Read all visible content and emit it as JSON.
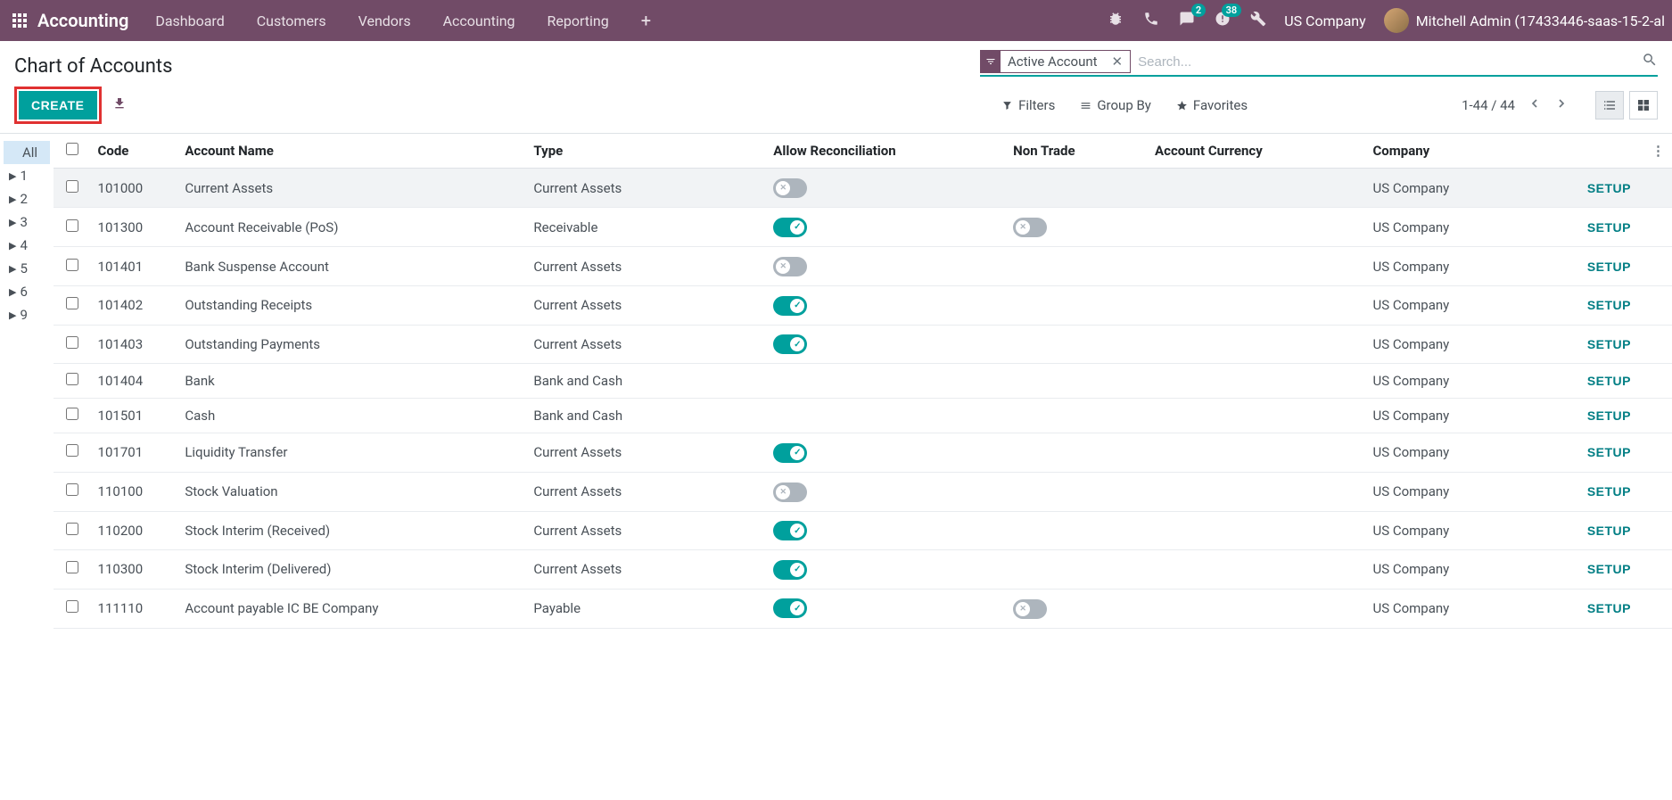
{
  "navbar": {
    "brand": "Accounting",
    "menu": [
      "Dashboard",
      "Customers",
      "Vendors",
      "Accounting",
      "Reporting"
    ],
    "messages_badge": "2",
    "activities_badge": "38",
    "company": "US Company",
    "user": "Mitchell Admin (17433446-saas-15-2-al"
  },
  "breadcrumb": "Chart of Accounts",
  "buttons": {
    "create": "CREATE"
  },
  "search": {
    "facet_label": "Active Account",
    "placeholder": "Search...",
    "filters": "Filters",
    "group_by": "Group By",
    "favorites": "Favorites"
  },
  "pager": {
    "range": "1-44 / 44"
  },
  "sidebar": {
    "items": [
      "All",
      "1",
      "2",
      "3",
      "4",
      "5",
      "6",
      "9"
    ]
  },
  "table": {
    "headers": {
      "code": "Code",
      "name": "Account Name",
      "type": "Type",
      "recon": "Allow Reconciliation",
      "nontrade": "Non Trade",
      "currency": "Account Currency",
      "company": "Company"
    },
    "setup_label": "SETUP",
    "rows": [
      {
        "code": "101000",
        "name": "Current Assets",
        "type": "Current Assets",
        "recon": "off",
        "nontrade": "",
        "company": "US Company"
      },
      {
        "code": "101300",
        "name": "Account Receivable (PoS)",
        "type": "Receivable",
        "recon": "on",
        "nontrade": "off",
        "company": "US Company"
      },
      {
        "code": "101401",
        "name": "Bank Suspense Account",
        "type": "Current Assets",
        "recon": "off",
        "nontrade": "",
        "company": "US Company"
      },
      {
        "code": "101402",
        "name": "Outstanding Receipts",
        "type": "Current Assets",
        "recon": "on",
        "nontrade": "",
        "company": "US Company"
      },
      {
        "code": "101403",
        "name": "Outstanding Payments",
        "type": "Current Assets",
        "recon": "on",
        "nontrade": "",
        "company": "US Company"
      },
      {
        "code": "101404",
        "name": "Bank",
        "type": "Bank and Cash",
        "recon": "",
        "nontrade": "",
        "company": "US Company"
      },
      {
        "code": "101501",
        "name": "Cash",
        "type": "Bank and Cash",
        "recon": "",
        "nontrade": "",
        "company": "US Company"
      },
      {
        "code": "101701",
        "name": "Liquidity Transfer",
        "type": "Current Assets",
        "recon": "on",
        "nontrade": "",
        "company": "US Company"
      },
      {
        "code": "110100",
        "name": "Stock Valuation",
        "type": "Current Assets",
        "recon": "off",
        "nontrade": "",
        "company": "US Company"
      },
      {
        "code": "110200",
        "name": "Stock Interim (Received)",
        "type": "Current Assets",
        "recon": "on",
        "nontrade": "",
        "company": "US Company"
      },
      {
        "code": "110300",
        "name": "Stock Interim (Delivered)",
        "type": "Current Assets",
        "recon": "on",
        "nontrade": "",
        "company": "US Company"
      },
      {
        "code": "111110",
        "name": "Account payable IC BE Company",
        "type": "Payable",
        "recon": "on",
        "nontrade": "off",
        "company": "US Company"
      }
    ]
  }
}
